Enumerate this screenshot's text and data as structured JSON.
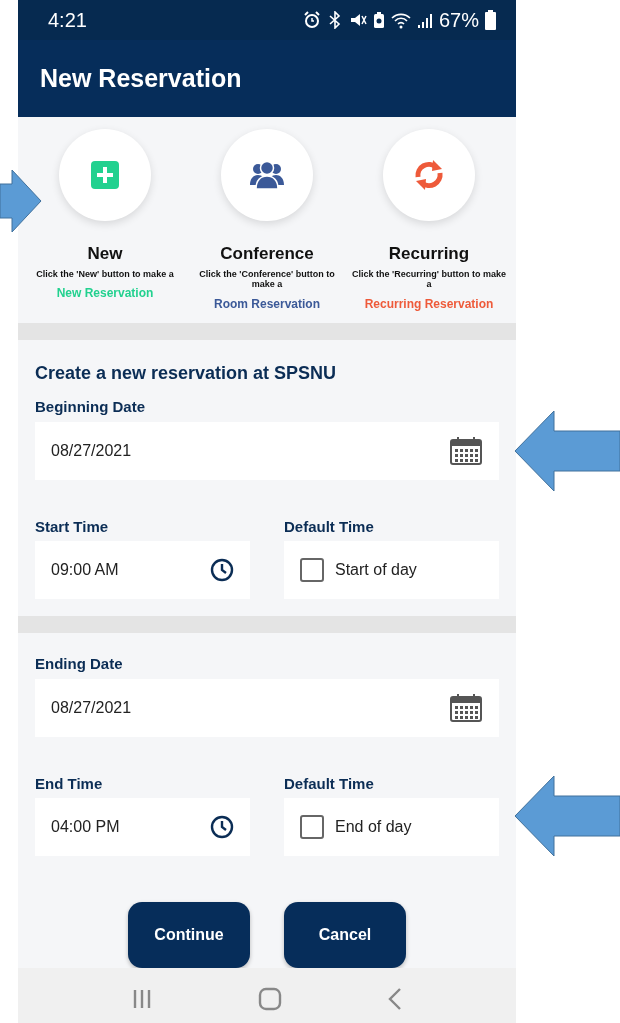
{
  "status_bar": {
    "time": "4:21",
    "battery": "67%"
  },
  "header": {
    "title": "New Reservation"
  },
  "options": [
    {
      "kind": "new",
      "title": "New",
      "description": "Click the 'New' button to make a",
      "link": "New Reservation",
      "color": "#22d18f"
    },
    {
      "kind": "conference",
      "title": "Conference",
      "description": "Click the 'Conference' button to make a",
      "link": "Room Reservation",
      "color": "#3b5998"
    },
    {
      "kind": "recurring",
      "title": "Recurring",
      "description": "Click the 'Recurring' button to make a",
      "link": "Recurring Reservation",
      "color": "#ee5a3a"
    }
  ],
  "form": {
    "heading": "Create a new reservation at SPSNU",
    "sections": [
      {
        "date_label": "Beginning Date",
        "date_value": "08/27/2021",
        "time_label": "Start Time",
        "time_value": "09:00 AM",
        "default_label": "Default Time",
        "checkbox_label": "Start of day",
        "checked": false
      },
      {
        "date_label": "Ending Date",
        "date_value": "08/27/2021",
        "time_label": "End Time",
        "time_value": "04:00 PM",
        "default_label": "Default Time",
        "checkbox_label": "End of day",
        "checked": false
      }
    ]
  },
  "buttons": [
    "Continue",
    "Cancel"
  ]
}
